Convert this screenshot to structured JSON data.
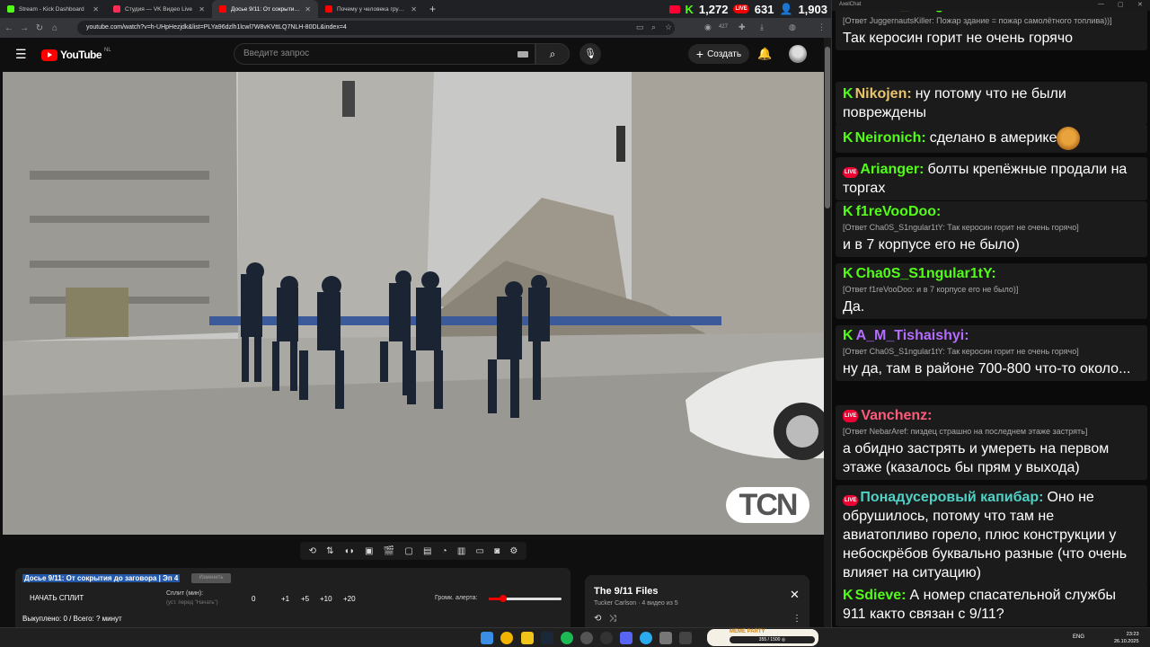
{
  "browser": {
    "tabs": [
      {
        "title": "Stream - Kick Dashboard",
        "icon": "kick-icon",
        "color": "#53fc18"
      },
      {
        "title": "Студия — VK Видео Live",
        "icon": "vk-live-icon",
        "color": "#ff2d55"
      },
      {
        "title": "Досье 9/11: От сокрытия д",
        "icon": "youtube-icon",
        "color": "#ff0000"
      },
      {
        "title": "Почему у человека грустно и",
        "icon": "youtube-icon",
        "color": "#ff0000"
      }
    ],
    "new_tab": "+",
    "url": "youtube.com/watch?v=h-UHpHezjdk&list=PLYa96dzlh1lcwl7W8vKVttLQ7NLH-80DL&index=4",
    "notif_count": "427",
    "stats": {
      "kick": "1,272",
      "vk": "631",
      "viewers": "1,903"
    }
  },
  "youtube": {
    "logo_text": "YouTube",
    "region": "NL",
    "search_placeholder": "Введите запрос",
    "create_label": "Создать"
  },
  "video": {
    "watermark": "TCN"
  },
  "split": {
    "title": "Досье 9/11: От сокрытия до заговора | Эп 4",
    "badge": "Изменить",
    "start": "НАЧАТЬ СПЛИТ",
    "split_label": "Сплит (мин):",
    "split_hint": "(уст. перед \"Начать\")",
    "value": "0",
    "buttons": [
      "+1",
      "+5",
      "+10",
      "+20"
    ],
    "volume_label": "Громк. алерта:",
    "volume": 0.2,
    "stats": "Выкуплено: 0 / Всего: ? минут"
  },
  "playlist": {
    "title": "The 9/11 Files",
    "subtitle": "Tucker Carlson · 4 видео из 5"
  },
  "chat": {
    "window_title": "AxelChat",
    "messages": [
      {
        "platform": "kick",
        "user": "Cha0S_S1ngular1tY:",
        "color": "#53fc18",
        "reply": "[Ответ JuggernautsKiller: Пожар здание = пожар самолётного топлива))]",
        "text": "Так керосин горит не очень горячо"
      },
      {
        "platform": "kick",
        "user": "Nikojen:",
        "color": "#e9c46a",
        "reply": "",
        "text": "ну потому что не были повреждены"
      },
      {
        "platform": "kick",
        "user": "Neironich:",
        "color": "#53fc18",
        "reply": "",
        "text": "сделано в америке"
      },
      {
        "platform": "vk",
        "user": "Arianger:",
        "color": "#53fc18",
        "reply": "",
        "text": "болты крепёжные продали на торгах"
      },
      {
        "platform": "kick",
        "user": "f1reVooDoo:",
        "color": "#53fc18",
        "reply": "[Ответ Cha0S_S1ngular1tY: Так керосин горит не очень горячо]",
        "text": "и в 7 корпусе его не было)"
      },
      {
        "platform": "kick",
        "user": "Cha0S_S1ngular1tY:",
        "color": "#53fc18",
        "reply": "[Ответ f1reVooDoo: и в 7 корпусе его не было)]",
        "text": "Да."
      },
      {
        "platform": "kick",
        "user": "A_M_Tishaishyi:",
        "color": "#b46cff",
        "reply": "[Ответ Cha0S_S1ngular1tY: Так керосин горит не очень горячо]",
        "text": "ну да, там в районе 700-800 что-то около..."
      },
      {
        "platform": "vk",
        "user": "Vanchenz:",
        "color": "#ff5a7a",
        "reply": "[Ответ NebarAref: пиздец страшно на последнем этаже застрять]",
        "text": "а обидно застрять и умереть на первом этаже (казалось бы прям у выхода)"
      },
      {
        "platform": "vk",
        "user": "Понадусеровый капибар:",
        "color": "#4fd1c5",
        "reply": "",
        "text": "Оно не обрушилось, потому что там не авиатопливо горело, плюс конструкции у небоскрёбов буквально разные (что очень влияет на ситуацию)"
      },
      {
        "platform": "kick",
        "user": "Sdieve:",
        "color": "#53fc18",
        "reply": "",
        "text": "А номер спасательной службы 911 както связан с 9/11?"
      }
    ]
  },
  "taskbar": {
    "meme_label": "MEME PARTY",
    "meme_progress": "355 / 1500 ◎",
    "lang": "ENG",
    "time": "23:23",
    "date": "26.10.2025"
  }
}
